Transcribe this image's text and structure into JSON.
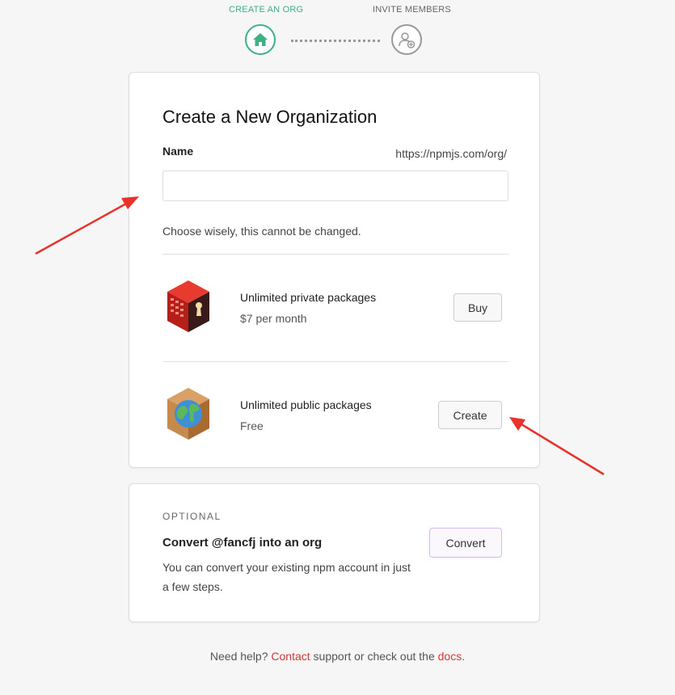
{
  "steps": [
    {
      "label": "CREATE AN ORG",
      "icon": "home-icon",
      "state": "active"
    },
    {
      "label": "INVITE MEMBERS",
      "icon": "add-user-icon",
      "state": "inactive"
    }
  ],
  "colors": {
    "accent": "#3db183",
    "link": "#cb3837",
    "annotation": "#e8322b"
  },
  "create_org": {
    "title": "Create a New Organization",
    "name_label": "Name",
    "url_prefix": "https://npmjs.com/org/",
    "name_value": "",
    "hint": "Choose wisely, this cannot be changed."
  },
  "plans": [
    {
      "icon": "private-package-box-icon",
      "title": "Unlimited private packages",
      "price": "$7 per month",
      "button": "Buy"
    },
    {
      "icon": "public-package-box-icon",
      "title": "Unlimited public packages",
      "price": "Free",
      "button": "Create"
    }
  ],
  "optional": {
    "label": "OPTIONAL",
    "title": "Convert @fancfj into an org",
    "description": "You can convert your existing npm account in just a few steps.",
    "button": "Convert"
  },
  "help": {
    "prefix": "Need help?",
    "contact_link": "Contact",
    "middle": "support or check out the",
    "docs_link": "docs",
    "suffix": "."
  }
}
